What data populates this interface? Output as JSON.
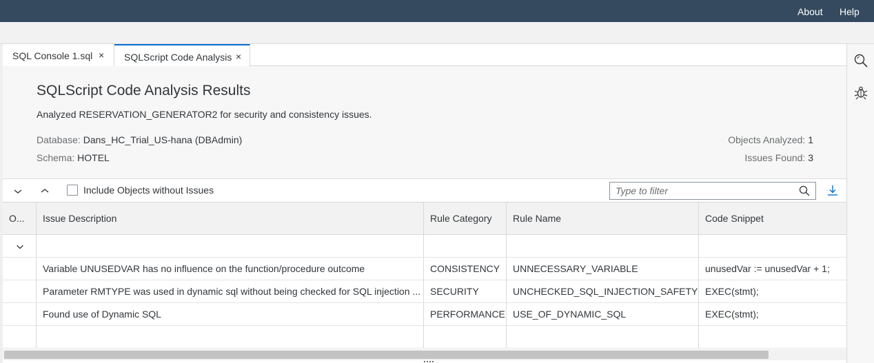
{
  "shell": {
    "about": "About",
    "help": "Help"
  },
  "tabs": [
    {
      "label": "SQL Console 1.sql",
      "close": "×",
      "active": false
    },
    {
      "label": "SQLScript Code Analysis",
      "close": "×",
      "active": true
    }
  ],
  "header": {
    "title": "SQLScript Code Analysis Results",
    "description": "Analyzed RESERVATION_GENERATOR2 for security and consistency issues.",
    "database_label": "Database:",
    "database_value": "Dans_HC_Trial_US-hana (DBAdmin)",
    "schema_label": "Schema:",
    "schema_value": "HOTEL",
    "objects_label": "Objects Analyzed:",
    "objects_value": "1",
    "issues_label": "Issues Found:",
    "issues_value": "3"
  },
  "toolbar": {
    "expand_icon": "chevron-down-icon",
    "collapse_icon": "chevron-up-icon",
    "checkbox_label": "Include Objects without Issues",
    "checkbox_checked": false,
    "filter_placeholder": "Type to filter",
    "download_icon": "download-icon"
  },
  "table": {
    "columns": [
      "O...",
      "Issue Description",
      "Rule Category",
      "Rule Name",
      "Code Snippet"
    ],
    "group_row_icon": "chevron-down-icon",
    "rows": [
      {
        "description": "Variable UNUSEDVAR has no influence on the function/procedure outcome",
        "category": "CONSISTENCY",
        "rule": "UNNECESSARY_VARIABLE",
        "snippet": "unusedVar := unusedVar + 1;"
      },
      {
        "description": "Parameter RMTYPE was used in dynamic sql without being checked for SQL injection ...",
        "category": "SECURITY",
        "rule": "UNCHECKED_SQL_INJECTION_SAFETY",
        "snippet": "EXEC(stmt);"
      },
      {
        "description": "Found use of Dynamic SQL",
        "category": "PERFORMANCE",
        "rule": "USE_OF_DYNAMIC_SQL",
        "snippet": "EXEC(stmt);"
      }
    ]
  },
  "right_panel": {
    "icons": [
      "search-objects-icon",
      "debug-icon"
    ]
  },
  "colors": {
    "shell": "#354a5f",
    "accent": "#0a6ed1",
    "text": "#32363a"
  }
}
